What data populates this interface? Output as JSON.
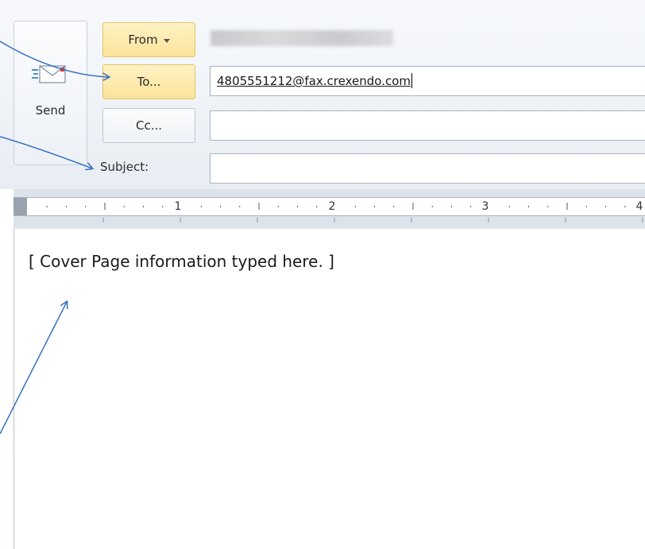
{
  "header": {
    "send_label": "Send",
    "from_label": "From",
    "to_label": "To...",
    "cc_label": "Cc...",
    "subject_label": "Subject:",
    "to_value": "4805551212@fax.crexendo.com",
    "cc_value": "",
    "subject_value": ""
  },
  "ruler": {
    "numbers": [
      "1",
      "2",
      "3",
      "4"
    ]
  },
  "body": {
    "text": "[ Cover Page information typed here. ]"
  },
  "colors": {
    "arrow": "#3a6fc0",
    "button_yellow": "#fbe39a",
    "border": "#abb3bf"
  }
}
